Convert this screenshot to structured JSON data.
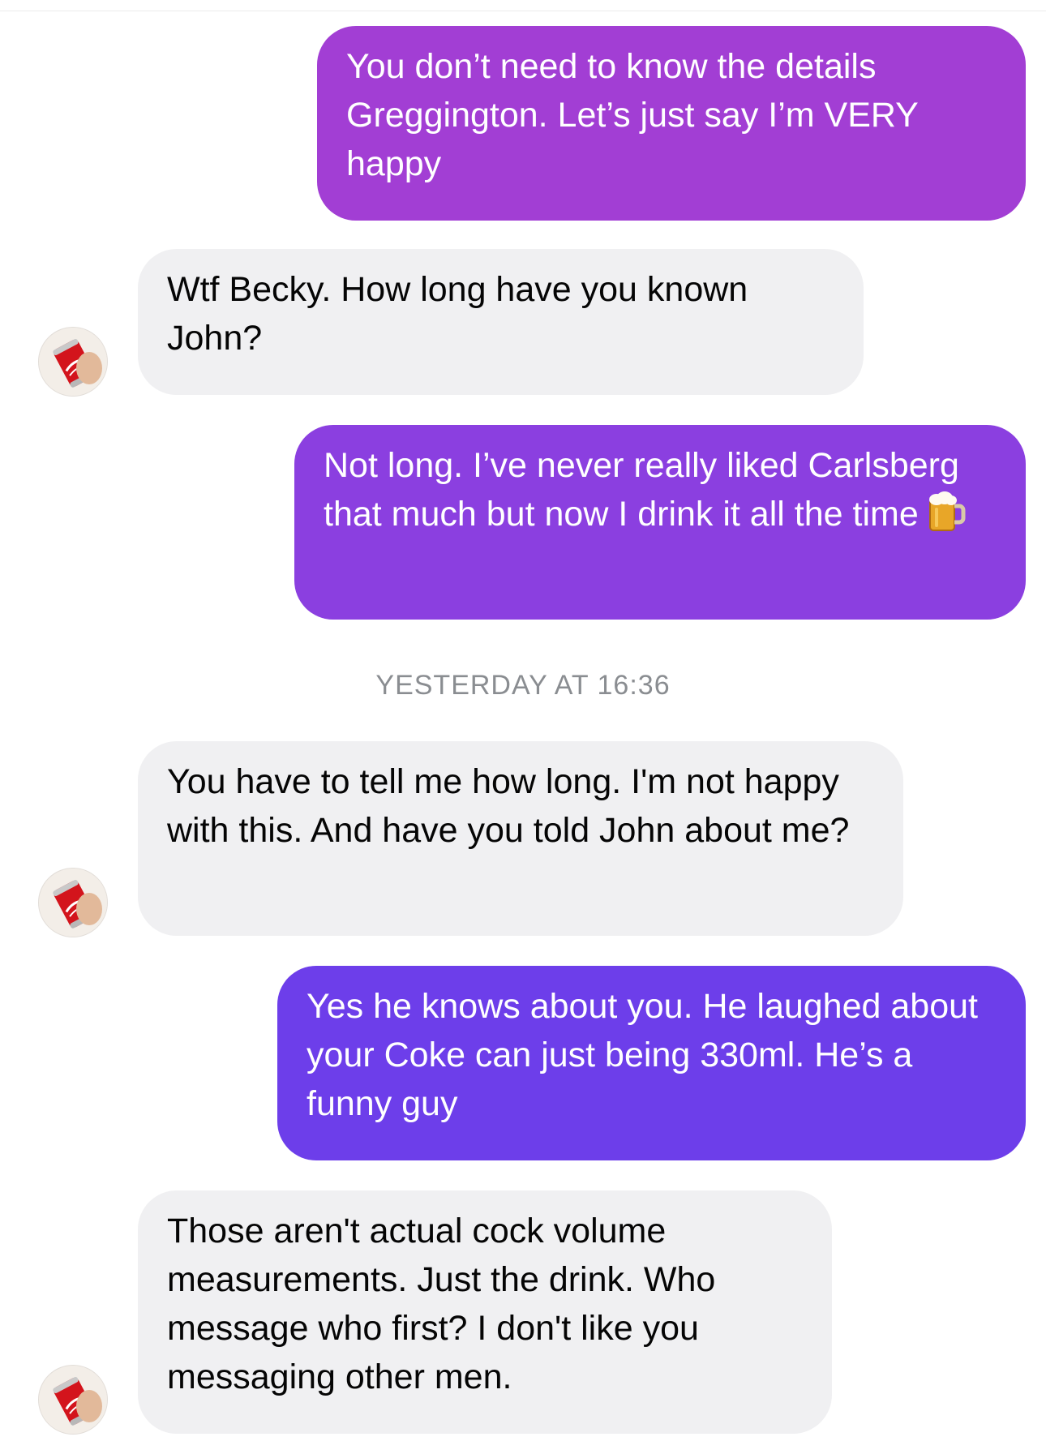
{
  "colors": {
    "outgoing_1": "#a23ed4",
    "outgoing_2": "#8b3fe0",
    "outgoing_3": "#6d3eea",
    "incoming": "#f0f0f2",
    "timestamp": "#8a8d91"
  },
  "messages": [
    {
      "text": "You don’t need to know the details Greggington. Let’s just say I’m VERY happy"
    },
    {
      "text": "Wtf Becky. How long have you known John?"
    },
    {
      "text": "Not long. I’ve never really liked Carlsberg that much but now I drink it all the time",
      "emoji": "beer-mug-icon"
    },
    {
      "text": "You have to tell me how long. I'm not happy with this. And have you told John about me?"
    },
    {
      "text": "Yes he knows about you. He laughed about your Coke can just being 330ml. He’s a funny guy"
    },
    {
      "text": "Those aren't actual cock volume measurements. Just the drink. Who message who first? I don't like you messaging other men."
    }
  ],
  "timestamp": "YESTERDAY AT 16:36",
  "avatar_icon": "coke-can-avatar-icon"
}
